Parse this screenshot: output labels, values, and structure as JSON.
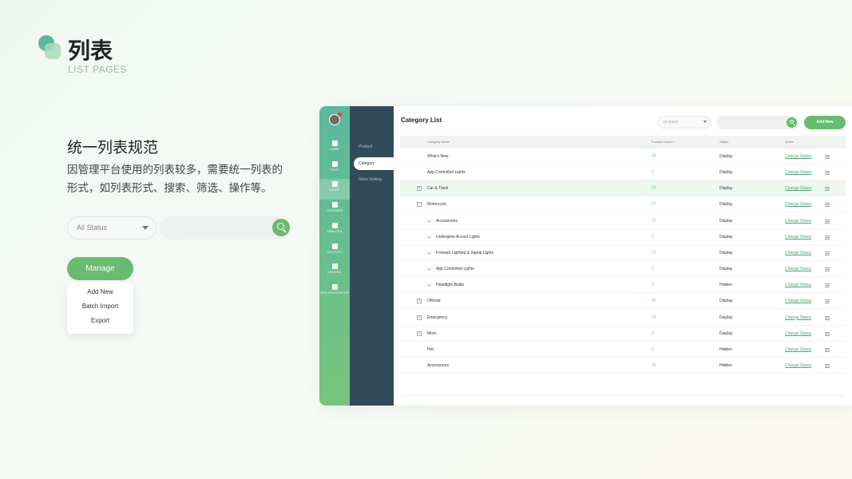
{
  "page": {
    "title": "列表",
    "subtitle": "LIST PAGES",
    "section_title": "统一列表规范",
    "section_desc": "因管理平台使用的列表较多，需要统一列表的形式，如列表形式、搜索、筛选、操作等。"
  },
  "demo": {
    "status_select": "All Status",
    "manage_label": "Manage",
    "menu": [
      "Add New",
      "Batch Import",
      "Export"
    ]
  },
  "rail": [
    {
      "label": "HOME",
      "icon": "home-icon"
    },
    {
      "label": "POST",
      "icon": "post-icon"
    },
    {
      "label": "STORE",
      "icon": "store-icon",
      "active": true
    },
    {
      "label": "CUSTOMER",
      "icon": "customer-icon"
    },
    {
      "label": "ANALYSIS",
      "icon": "analysis-icon"
    },
    {
      "label": "ACCOUNT",
      "icon": "account-icon"
    },
    {
      "label": "SENDING",
      "icon": "sending-icon"
    },
    {
      "label": "SITE INTEGRATION",
      "icon": "site-integration-icon"
    }
  ],
  "subnav": [
    {
      "label": "Product"
    },
    {
      "label": "Category",
      "active": true
    },
    {
      "label": "Store Setting"
    }
  ],
  "main": {
    "title": "Category List",
    "status_select": "All Status",
    "add_new_label": "Add New"
  },
  "table": {
    "headers": {
      "name": "Category Name",
      "count": "Product Count ↕",
      "status": "Status",
      "action": "Action"
    },
    "rows": [
      {
        "name": "What's New",
        "count": "19",
        "status": "Display",
        "action": "Change Status",
        "level": 0,
        "toggle": ""
      },
      {
        "name": "App Controlled Lights",
        "count": "5",
        "status": "Display",
        "action": "Change Status",
        "level": 0,
        "toggle": ""
      },
      {
        "name": "Car & Truck",
        "count": "53",
        "status": "Display",
        "action": "Change Status",
        "level": 0,
        "toggle": "+",
        "highlight": true
      },
      {
        "name": "Motorcycle",
        "count": "27",
        "status": "Display",
        "action": "Change Status",
        "level": 0,
        "toggle": "−"
      },
      {
        "name": "Accessories",
        "count": "27",
        "status": "Display",
        "action": "Change Status",
        "level": 1,
        "toggle": ""
      },
      {
        "name": "Underglow Accent Lights",
        "count": "5",
        "status": "Display",
        "action": "Change Status",
        "level": 1,
        "toggle": ""
      },
      {
        "name": "Forward Lighting & Signal Lights",
        "count": "17",
        "status": "Display",
        "action": "Change Status",
        "level": 1,
        "toggle": ""
      },
      {
        "name": "App Controlled Lights",
        "count": "6",
        "status": "Display",
        "action": "Change Status",
        "level": 1,
        "toggle": ""
      },
      {
        "name": "Headlight Bulbs",
        "count": "3",
        "status": "Hidden",
        "action": "Change Status",
        "level": 1,
        "toggle": ""
      },
      {
        "name": "Offroad",
        "count": "42",
        "status": "Display",
        "action": "Change Status",
        "level": 0,
        "toggle": "+"
      },
      {
        "name": "Emergency",
        "count": "14",
        "status": "Display",
        "action": "Change Status",
        "level": 0,
        "toggle": "+"
      },
      {
        "name": "More",
        "count": "9",
        "status": "Display",
        "action": "Change Status",
        "level": 0,
        "toggle": "+"
      },
      {
        "name": "Hot",
        "count": "5",
        "status": "Hidden",
        "action": "Change Status",
        "level": 0,
        "toggle": ""
      },
      {
        "name": "Accessories",
        "count": "75",
        "status": "Hidden",
        "action": "Change Status",
        "level": 0,
        "toggle": ""
      }
    ]
  },
  "colors": {
    "accent_green": "#69bb6f",
    "rail_gradient_top": "#5ab89d",
    "rail_gradient_bottom": "#77c47d",
    "subnav_bg": "#324b5a",
    "notification_dot": "#e24646"
  }
}
